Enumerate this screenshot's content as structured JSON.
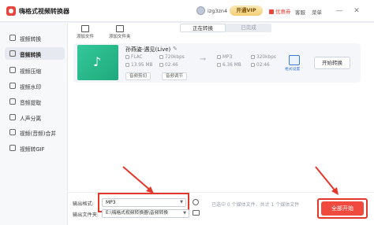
{
  "app": {
    "title": "嗨格式视频转换器",
    "username": "izg3zn4",
    "vip_label": "开通VIP",
    "coupon_label": "优惠券",
    "help_label": "客服",
    "menu_label": "菜单",
    "minimize_glyph": "—",
    "close_glyph": "✕"
  },
  "sidebar": {
    "items": [
      {
        "label": "视频转换",
        "icon": "video-icon"
      },
      {
        "label": "音频转换",
        "icon": "audio-icon",
        "active": true
      },
      {
        "label": "视频压缩",
        "icon": "compress-icon"
      },
      {
        "label": "视频水印",
        "icon": "watermark-icon"
      },
      {
        "label": "音频提取",
        "icon": "extract-icon"
      },
      {
        "label": "人声分离",
        "icon": "vocal-icon"
      },
      {
        "label": "视频(音频)合并",
        "icon": "merge-icon"
      },
      {
        "label": "视频转GIF",
        "icon": "gif-icon"
      }
    ]
  },
  "toolbar": {
    "add_file": "添加文件",
    "add_folder": "添加文件夹"
  },
  "tabs": {
    "converting": "正在转换",
    "done": "已完成"
  },
  "file": {
    "name": "孙燕姿-遇见(Live)",
    "source": {
      "format": "FLAC",
      "bitrate": "720kbps",
      "size": "13.95 MB",
      "duration": "02:46"
    },
    "target": {
      "format": "MP3",
      "bitrate": "320kbps",
      "size": "6.36 MB",
      "duration": "02:46"
    },
    "clip_label": "音频剪切",
    "adjust_label": "音频调节",
    "settings_label": "格式设置",
    "start_label": "开始转换",
    "note_glyph": "♪",
    "edit_glyph": "✎",
    "arrow_glyph": "➞"
  },
  "bottom": {
    "format_label": "输出格式:",
    "format_value": "MP3",
    "folder_label": "输出文件夹:",
    "folder_value": "E:\\嗨格式视频转换器\\音频转换",
    "status": "已选中 0 个媒体文件，共计 1 个媒体文件",
    "all_start_label": "全部开始",
    "dropdown_glyph": "▼"
  },
  "colors": {
    "accent": "#f04a3e",
    "highlight": "#e3372a",
    "thumb": "#1fa97c",
    "link": "#3a7bd5"
  }
}
